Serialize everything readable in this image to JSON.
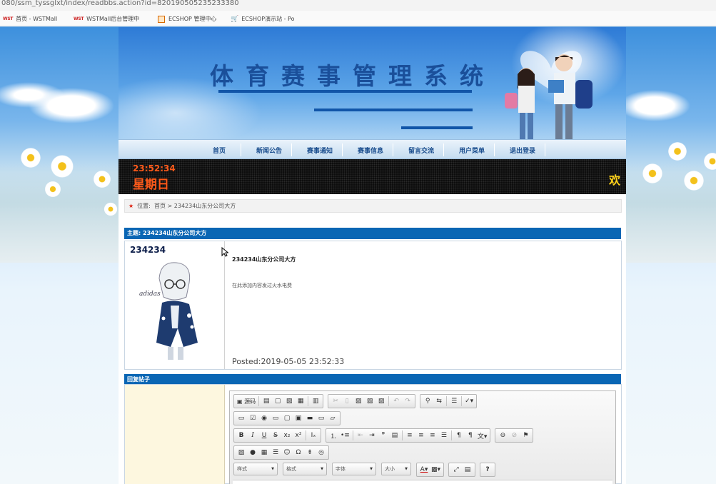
{
  "browser": {
    "url": "080/ssm_tyssglxt/index/readbbs.action?id=820190505235233380",
    "bookmarks": [
      {
        "icon": "wst",
        "label": "首页 - WSTMall"
      },
      {
        "icon": "wst",
        "label": "WSTMall后台管理中"
      },
      {
        "icon": "ecshop",
        "label": "ECSHOP 管理中心"
      },
      {
        "icon": "cart",
        "label": "ECSHOP演示站 - Po"
      }
    ]
  },
  "site": {
    "title": "体育赛事管理系统"
  },
  "nav": [
    "首页",
    "新闻公告",
    "赛事通知",
    "赛事信息",
    "留言交流",
    "用户菜单",
    "退出登录"
  ],
  "led": {
    "time": "23:52:34",
    "day": "星期日",
    "scroll": "欢"
  },
  "breadcrumb": {
    "label": "位置:",
    "items": [
      "首页",
      "234234山东分公司大方"
    ],
    "sep": ">"
  },
  "thread": {
    "topic_label": "主题:",
    "topic": "234234山东分公司大方",
    "author": "234234",
    "title": "234234山东分公司大方",
    "body": "在此添加内容发过火水电费",
    "posted": "Posted:2019-05-05 23:52:33"
  },
  "reply": {
    "header": "回复帖子"
  },
  "editor": {
    "source_label": "源码",
    "combos": [
      "样式",
      "格式",
      "字体",
      "大小"
    ],
    "help": "?"
  },
  "colors": {
    "accent": "#0a66b4",
    "led_text": "#ff5a1a",
    "led_scroll": "#ffd21a"
  }
}
